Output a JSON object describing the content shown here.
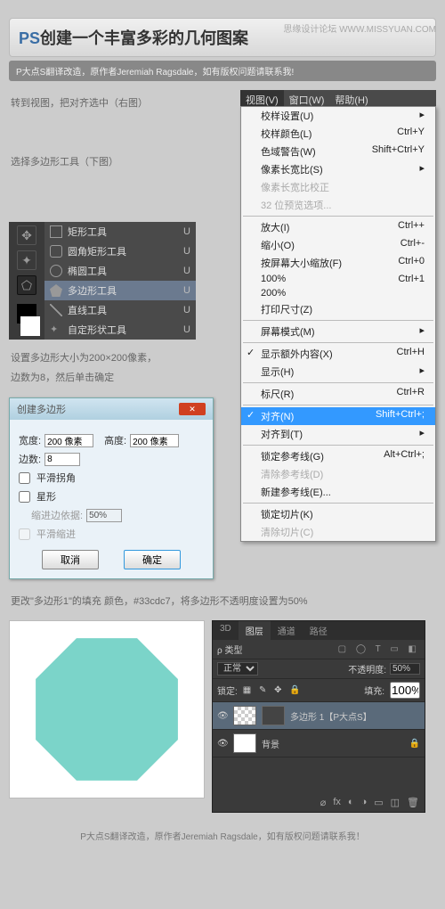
{
  "watermark": "思缘设计论坛  WWW.MISSYUAN.COM",
  "header": {
    "ps": "PS",
    "title": "创建一个丰富多彩的几何图案"
  },
  "subtitle": "P大点S翻译改造，原作者Jeremiah Ragsdale，如有版权问题请联系我!",
  "txt1": "转到视图，把对齐选中（右图）",
  "txt2": "选择多边形工具（下图）",
  "txt3a": "设置多边形大小为200×200像素，",
  "txt3b": "边数为8，然后单击确定",
  "txt4": "更改\"多边形1\"的填充 颜色，#33cdc7，将多边形不透明度设置为50%",
  "menubar": {
    "view": "视图(V)",
    "window": "窗口(W)",
    "help": "帮助(H)"
  },
  "menu": {
    "proof_setup": "校样设置(U)",
    "proof_colors": "校样颜色(L)",
    "proof_colors_k": "Ctrl+Y",
    "gamut": "色域警告(W)",
    "gamut_k": "Shift+Ctrl+Y",
    "pixel_ratio": "像素长宽比(S)",
    "pixel_corr": "像素长宽比校正",
    "bit32": "32 位预览选项...",
    "zoom_in": "放大(I)",
    "zoom_in_k": "Ctrl++",
    "zoom_out": "缩小(O)",
    "zoom_out_k": "Ctrl+-",
    "fit": "按屏幕大小缩放(F)",
    "fit_k": "Ctrl+0",
    "p100": "100%",
    "p100_k": "Ctrl+1",
    "p200": "200%",
    "print_size": "打印尺寸(Z)",
    "screen_mode": "屏幕模式(M)",
    "extras": "显示额外内容(X)",
    "extras_k": "Ctrl+H",
    "show": "显示(H)",
    "rulers": "标尺(R)",
    "rulers_k": "Ctrl+R",
    "snap": "对齐(N)",
    "snap_k": "Shift+Ctrl+;",
    "snap_to": "对齐到(T)",
    "lock_guides": "锁定参考线(G)",
    "lock_guides_k": "Alt+Ctrl+;",
    "clear_guides": "清除参考线(D)",
    "new_guide": "新建参考线(E)...",
    "lock_slices": "锁定切片(K)",
    "clear_slices": "清除切片(C)"
  },
  "tools": {
    "rect": "矩形工具",
    "rrect": "圆角矩形工具",
    "ellipse": "椭圆工具",
    "polygon": "多边形工具",
    "line": "直线工具",
    "custom": "自定形状工具",
    "key": "U"
  },
  "dialog": {
    "title": "创建多边形",
    "width_l": "宽度:",
    "width_v": "200 像素",
    "height_l": "高度:",
    "height_v": "200 像素",
    "sides_l": "边数:",
    "sides_v": "8",
    "smooth": "平滑拐角",
    "star": "星形",
    "indent_l": "缩进边依据:",
    "indent_v": "50%",
    "smooth_indent": "平滑缩进",
    "cancel": "取消",
    "ok": "确定"
  },
  "layers": {
    "tabs": {
      "d3": "3D",
      "layers": "图层",
      "channels": "通道",
      "paths": "路径"
    },
    "kind": "ρ 类型",
    "mode": "正常",
    "opacity_l": "不透明度:",
    "opacity_v": "50%",
    "lock_l": "锁定:",
    "fill_l": "填充:",
    "fill_v": "100%",
    "layer1": "多边形 1【P大点S】",
    "bg": "背景"
  },
  "footer": "P大点S翻译改造，原作者Jeremiah Ragsdale，如有版权问题请联系我！"
}
